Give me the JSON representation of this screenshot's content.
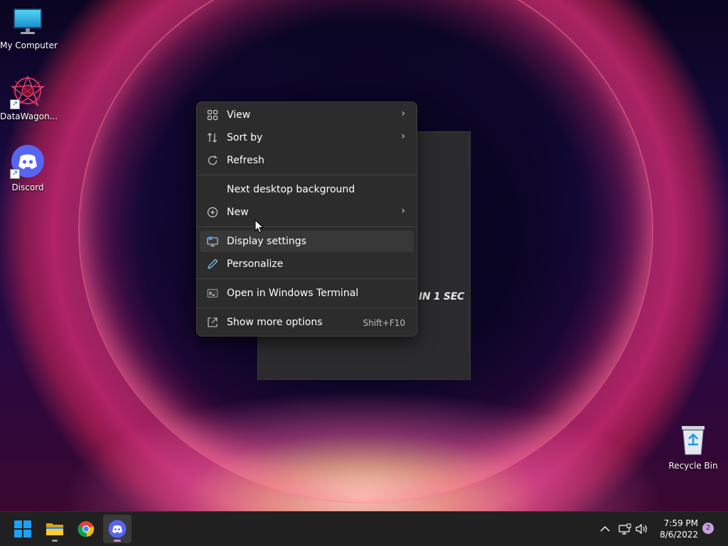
{
  "desktop": {
    "icons": [
      {
        "label": "My Computer",
        "icon": "monitor-icon"
      },
      {
        "label": "DataWagon...",
        "icon": "datawagon-icon"
      },
      {
        "label": "Discord",
        "icon": "discord-icon"
      },
      {
        "label": "Recycle Bin",
        "icon": "recycle-bin-icon"
      }
    ],
    "background_window_text": "IN 1 SEC"
  },
  "context_menu": {
    "items": [
      {
        "label": "View",
        "icon": "grid-icon",
        "submenu": true
      },
      {
        "label": "Sort by",
        "icon": "sort-icon",
        "submenu": true
      },
      {
        "label": "Refresh",
        "icon": "refresh-icon"
      },
      {
        "label": "Next desktop background"
      },
      {
        "label": "New",
        "icon": "plus-circle-icon",
        "submenu": true
      },
      {
        "label": "Display settings",
        "icon": "display-icon",
        "highlighted": true
      },
      {
        "label": "Personalize",
        "icon": "pen-icon"
      },
      {
        "label": "Open in Windows Terminal",
        "icon": "terminal-icon"
      },
      {
        "label": "Show more options",
        "icon": "share-icon",
        "shortcut": "Shift+F10"
      }
    ]
  },
  "taskbar": {
    "apps": [
      {
        "name": "Start",
        "icon": "windows-start-icon"
      },
      {
        "name": "File Explorer",
        "icon": "folder-icon",
        "running": true
      },
      {
        "name": "Google Chrome",
        "icon": "chrome-icon"
      },
      {
        "name": "Discord",
        "icon": "discord-icon",
        "running": true,
        "active": true
      }
    ],
    "tray": {
      "icons": [
        "chevron-up-icon",
        "network-icon",
        "volume-icon"
      ],
      "time": "7:59 PM",
      "date": "8/6/2022",
      "notification_count": "2"
    }
  },
  "colors": {
    "menu_bg": "#2c2c2c",
    "taskbar_bg": "#202020",
    "accent_discord": "#5865f2",
    "accent_windows": "#1e90ff"
  }
}
